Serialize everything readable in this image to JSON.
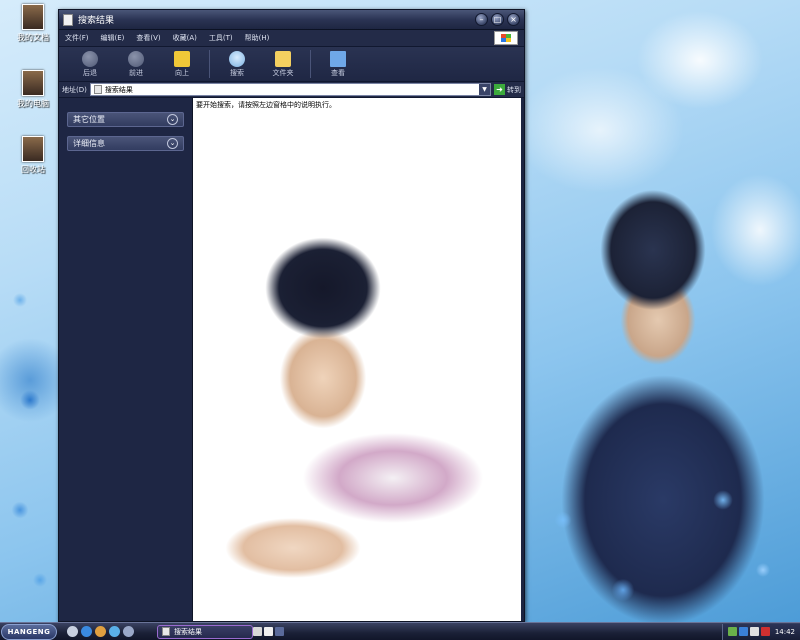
{
  "desktop": {
    "icons": [
      {
        "label": "我的文档"
      },
      {
        "label": "我的电脑"
      },
      {
        "label": "回收站"
      }
    ]
  },
  "window": {
    "title": "搜索结果",
    "controls": {
      "minimize": "–",
      "maximize": "□",
      "close": "×"
    }
  },
  "menu": {
    "items": [
      "文件(F)",
      "编辑(E)",
      "查看(V)",
      "收藏(A)",
      "工具(T)",
      "帮助(H)"
    ]
  },
  "toolbar": {
    "back": "后退",
    "forward": "前进",
    "up": "向上",
    "search": "搜索",
    "folders": "文件夹",
    "views": "查看"
  },
  "address": {
    "label": "地址(D)",
    "value": "搜索结果",
    "go": "转到"
  },
  "sidebar": {
    "groups": [
      {
        "title": "其它位置",
        "toggle": "⌄"
      },
      {
        "title": "详细信息",
        "toggle": "⌄"
      }
    ]
  },
  "content": {
    "hint": "要开始搜索，请按照左边窗格中的说明执行。"
  },
  "taskbar": {
    "start_label": "HANGENG",
    "task_title": "搜索结果",
    "time": "14:42"
  },
  "colors": {
    "window_dark": "#1c2440",
    "taskbar": "#1a2036",
    "content_bg": "#ffffff",
    "go_green": "#3caa3c"
  }
}
